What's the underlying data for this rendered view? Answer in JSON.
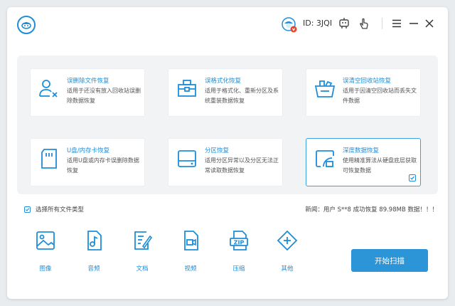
{
  "titlebar": {
    "user_id": "ID: 3JQI",
    "menu_icon": "menu-icon",
    "minimize_icon": "minimize-icon",
    "close_icon": "close-icon"
  },
  "modes": [
    {
      "title": "误删除文件恢复",
      "desc": "适用于还没有放入回收站误删除数据恢复",
      "icon": "delete-user-icon",
      "selected": false
    },
    {
      "title": "误格式化恢复",
      "desc": "适用于格式化、重新分区及系统重装数据恢复",
      "icon": "format-toolbox-icon",
      "selected": false
    },
    {
      "title": "误清空回收站恢复",
      "desc": "适用于因清空回收站而丢失文件数据",
      "icon": "recycle-basket-icon",
      "selected": false
    },
    {
      "title": "U盘/内存卡恢复",
      "desc": "适用U盘或内存卡误删除数据恢复",
      "icon": "sd-card-icon",
      "selected": false
    },
    {
      "title": "分区恢复",
      "desc": "适用分区异常以及分区无法正常读取数据恢复",
      "icon": "hard-drive-icon",
      "selected": false
    },
    {
      "title": "深度数据恢复",
      "desc": "使用精准算法从硬盘底层获取可恢复数据",
      "icon": "deep-scan-icon",
      "selected": true
    }
  ],
  "select_all": {
    "label": "选择所有文件类型",
    "checked": true
  },
  "news": "新闻：用户 S**8 成功恢复 89.98MB 数据！！！",
  "file_types": [
    {
      "label": "图像",
      "icon": "image-icon"
    },
    {
      "label": "音频",
      "icon": "audio-icon"
    },
    {
      "label": "文档",
      "icon": "document-icon"
    },
    {
      "label": "视频",
      "icon": "video-icon"
    },
    {
      "label": "压缩",
      "icon": "zip-icon"
    },
    {
      "label": "其他",
      "icon": "other-icon"
    }
  ],
  "start_button": "开始扫描",
  "colors": {
    "accent": "#1e8ed8",
    "button": "#2b95d8",
    "panel": "#f1f3f5",
    "badge": "#e8462a"
  }
}
